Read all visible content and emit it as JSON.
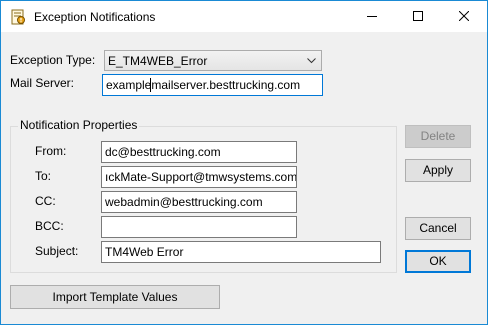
{
  "window": {
    "title": "Exception Notifications"
  },
  "form": {
    "exception_type_label": "Exception Type:",
    "exception_type_value": "E_TM4WEB_Error",
    "mail_server_label": "Mail Server:",
    "mail_server_value": "examplemailserver.besttrucking.com"
  },
  "notification": {
    "group_title": "Notification Properties",
    "from_label": "From:",
    "from_value": "dc@besttrucking.com",
    "to_label": "To:",
    "to_value": "ıckMate-Support@tmwsystems.com",
    "cc_label": "CC:",
    "cc_value": "webadmin@besttrucking.com",
    "bcc_label": "BCC:",
    "bcc_value": "",
    "subject_label": "Subject:",
    "subject_value": "TM4Web Error"
  },
  "buttons": {
    "delete": "Delete",
    "apply": "Apply",
    "cancel": "Cancel",
    "ok": "OK",
    "import_template": "Import Template Values"
  }
}
